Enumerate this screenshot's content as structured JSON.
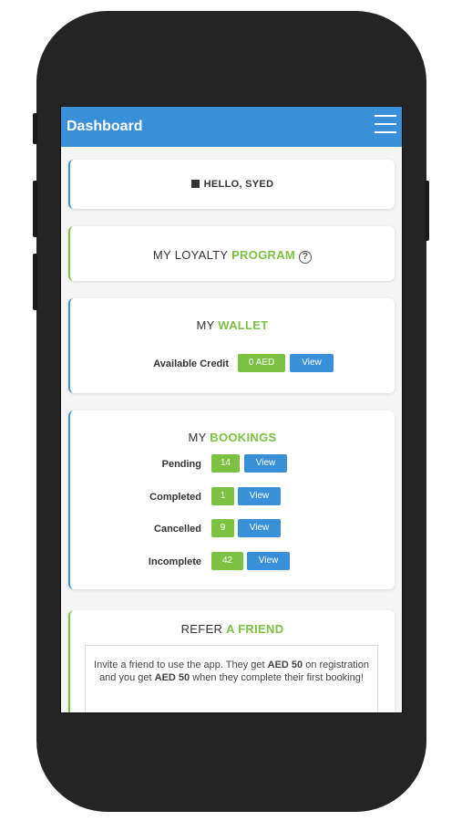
{
  "header": {
    "title": "Dashboard",
    "menu_icon": "hamburger-icon"
  },
  "greeting": {
    "text": "HELLO, SYED",
    "icon": "user-icon"
  },
  "loyalty": {
    "prefix": "MY LOYALTY ",
    "accent": "PROGRAM",
    "help_icon": "?"
  },
  "wallet": {
    "prefix": "MY ",
    "accent": "WALLET",
    "credit_label": "Available Credit",
    "credit_value": "0 AED",
    "view_label": "View"
  },
  "bookings": {
    "prefix": "MY ",
    "accent": "BOOKINGS",
    "items": [
      {
        "label": "Pending",
        "count": "14",
        "view": "View"
      },
      {
        "label": "Completed",
        "count": "1",
        "view": "View"
      },
      {
        "label": "Cancelled",
        "count": "9",
        "view": "View"
      },
      {
        "label": "Incomplete",
        "count": "42",
        "view": "View"
      }
    ]
  },
  "refer": {
    "prefix": "REFER ",
    "accent": "A FRIEND",
    "text1": "Invite a friend to use the app. They get ",
    "amount1": "AED 50",
    "text2": " on registration and you get ",
    "amount2": "AED 50",
    "text3": " when they complete their first booking!"
  },
  "colors": {
    "primary": "#3a8fd9",
    "accent": "#7cc142",
    "phone_body": "#242424"
  }
}
